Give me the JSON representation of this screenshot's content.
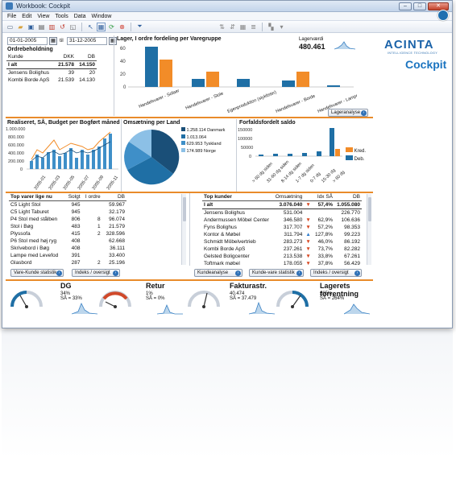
{
  "window": {
    "title": "Workbook: Cockpit"
  },
  "menu": {
    "items": [
      "File",
      "Edit",
      "View",
      "Tools",
      "Data",
      "Window"
    ]
  },
  "dates": {
    "from": "01-01-2005",
    "til_label": "til",
    "to": "31-12-2005"
  },
  "ordre": {
    "title": "Ordrebeholdning",
    "headers": [
      "Kunde",
      "DKK",
      "DB"
    ],
    "rows": [
      [
        "I alt",
        "21.578",
        "14.150"
      ],
      [
        "Jensens Bolighus",
        "39",
        "20"
      ],
      [
        "Kombi Borde ApS",
        "21.539",
        "14.130"
      ]
    ]
  },
  "lager": {
    "title": "Lager, I ordre fordeling per Varegruppe",
    "value_label": "Lagerværdi",
    "value": "480.461",
    "button": "Lageranalyse",
    "colors": {
      "blue": "#1f6fa5",
      "orange": "#f28c28"
    }
  },
  "brand": {
    "name": "ACINTA",
    "tagline": "INTELLIGENCE TECHNOLOGY",
    "product": "Cockpit"
  },
  "realiseret": {
    "title": "Realiseret, SÅ, Budget per Bogført måned"
  },
  "omsaetning_land": {
    "title": "Omsætning per Land",
    "legend": [
      {
        "value": "1.258.114",
        "label": "Danmark",
        "color": "#1a4f78"
      },
      {
        "value": "1.013.064",
        "label": "",
        "color": "#1f6fa5"
      },
      {
        "value": "629.953",
        "label": "Tyskland",
        "color": "#3f8fc8"
      },
      {
        "value": "174.989",
        "label": "Norge",
        "color": "#8cc0e6"
      }
    ]
  },
  "forfalds": {
    "title": "Forfaldsfordelt saldo",
    "legend": [
      {
        "label": "Kred.",
        "color": "#f28c28"
      },
      {
        "label": "Deb.",
        "color": "#1f6fa5"
      }
    ]
  },
  "top_varer": {
    "title": "Top varer lige nu",
    "headers": [
      "",
      "Solgt",
      "I ordre",
      "DB"
    ],
    "rows": [
      [
        "C5 Light Stol",
        "945",
        "",
        "59.967"
      ],
      [
        "C5 Light Taburet",
        "945",
        "",
        "32.179"
      ],
      [
        "P4 Stol med stålben",
        "806",
        "8",
        "96.074"
      ],
      [
        "Stol i Bøg",
        "483",
        "1",
        "21.579"
      ],
      [
        "Plyssofa",
        "415",
        "2",
        "328.596"
      ],
      [
        "P6 Stol med høj ryg",
        "408",
        "",
        "62.668"
      ],
      [
        "Skrivebord i Bøg",
        "408",
        "",
        "36.111"
      ],
      [
        "Lampe med Levefod",
        "391",
        "",
        "33.400"
      ],
      [
        "Glasbord",
        "287",
        "2",
        "25.196"
      ]
    ],
    "buttons": [
      "Vare-Kunde statistik",
      "Indeks / oversigt"
    ]
  },
  "top_kunder": {
    "title": "Top kunder",
    "headers": [
      "",
      "Omsætning",
      "Idx SÅ",
      "DB"
    ],
    "rows": [
      [
        "I alt",
        "3.076.040",
        "▼",
        "57,4%",
        "1.055.080"
      ],
      [
        "Jensens Bolighus",
        "531.004",
        "",
        "",
        "226.770"
      ],
      [
        "Andermussen Möbel Center",
        "346.580",
        "▼",
        "62,9%",
        "106.636"
      ],
      [
        "Fyns Bolighus",
        "317.707",
        "▼",
        "57,2%",
        "98.353"
      ],
      [
        "Kontor & Møbel",
        "311.794",
        "▲",
        "127,8%",
        "99.223"
      ],
      [
        "Schmidt Möbelvertrieb",
        "283.273",
        "▼",
        "46,0%",
        "86.192"
      ],
      [
        "Kombi Borde ApS",
        "237.261",
        "▼",
        "73,7%",
        "82.282"
      ],
      [
        "Gelsted Boligcenter",
        "213.538",
        "▼",
        "33,8%",
        "67.261"
      ],
      [
        "Toftmark møbel",
        "178.055",
        "▼",
        "37,8%",
        "56.429"
      ]
    ],
    "buttons": [
      "Kundeanalyse",
      "Kunde-vare statistik",
      "Indeks / oversigt"
    ]
  },
  "kpis": [
    {
      "title": "DG",
      "val1": "34%",
      "val2": "SÅ = 33%"
    },
    {
      "title": "Retur",
      "val1": "1%",
      "val2": "SÅ = 0%"
    },
    {
      "title": "Fakturastr.",
      "val1": "40.474",
      "val2": "SÅ = 37.479"
    },
    {
      "title": "Lagerets forrentning",
      "val1": "205%",
      "val2": "SÅ = 264%"
    }
  ]
}
